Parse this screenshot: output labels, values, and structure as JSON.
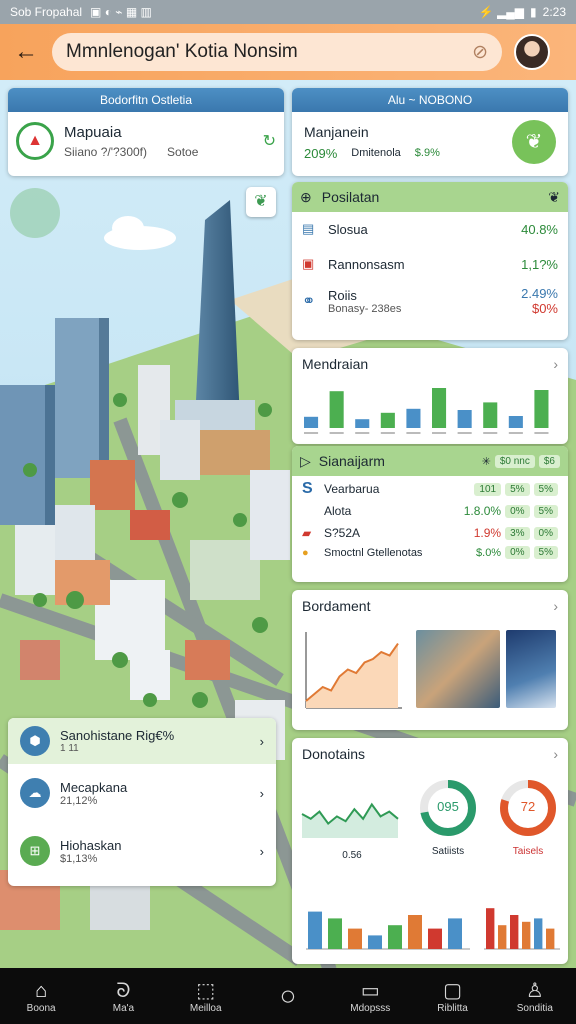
{
  "status": {
    "left": "Sob Fropahal",
    "time": "2:23"
  },
  "appbar": {
    "search_text": "Mmnlenogan' Kotia Nonsim"
  },
  "left_card": {
    "header": "Bodorfitn Ostletia",
    "title": "Mapuaia",
    "subtitle": "Siiano ?/'?300f)",
    "action": "Sotoe"
  },
  "right_card": {
    "header": "Alu ~ NOBONO",
    "title": "Manjanein",
    "value": "209%",
    "action": "Dmitenola",
    "pct": "$.9%"
  },
  "green_list": {
    "title": "Posilatan",
    "items": [
      {
        "label": "Slosua",
        "value": "40.8%"
      },
      {
        "label": "Rannonsasm",
        "value": "1,1?%"
      },
      {
        "label": "Roiis",
        "sub": "Bonasy- 238es",
        "value": "2.49%",
        "value2": "$0%"
      }
    ]
  },
  "bar_card": {
    "title": "Mendraian",
    "bars": [
      0.28,
      0.92,
      0.22,
      0.38,
      0.48,
      1.0,
      0.45,
      0.64,
      0.3,
      0.95
    ]
  },
  "stat_card": {
    "title": "Sianaijarm",
    "header_chips": [
      "$0 nnc",
      "$6"
    ],
    "rows": [
      {
        "label": "Vearbarua",
        "chips": [
          "101",
          "5%",
          "5%"
        ]
      },
      {
        "label": "Alota",
        "value": "1.8.0%",
        "chips": [
          "0%",
          "5%"
        ]
      },
      {
        "label": "S?52A",
        "value": "1.9%",
        "chips": [
          "3%",
          "0%"
        ]
      },
      {
        "label": "Smoctnl Gtellenotas",
        "value": "$.0%",
        "chips": [
          "0%",
          "5%"
        ]
      }
    ]
  },
  "media_card": {
    "title": "Bordament",
    "line_points": [
      0.1,
      0.2,
      0.3,
      0.25,
      0.45,
      0.55,
      0.5,
      0.65,
      0.7,
      0.8,
      0.75,
      0.92
    ]
  },
  "donut_card": {
    "title": "Donotains",
    "spark_label": "0.56",
    "donut1": {
      "value": "095",
      "label": "Satiists",
      "fraction": 0.72,
      "color": "#2a9a6b"
    },
    "donut2": {
      "value": "72",
      "label": "Taisels",
      "fraction": 0.8,
      "color": "#e0572a"
    },
    "bars_left": [
      0.55,
      0.45,
      0.3,
      0.2,
      0.35,
      0.5,
      0.3,
      0.45
    ],
    "bars_right": [
      0.6,
      0.35,
      0.5,
      0.4,
      0.45,
      0.3
    ]
  },
  "left_list": {
    "items": [
      {
        "title": "Sanohistane Rig€%",
        "sub": "1 11"
      },
      {
        "title": "Mecapkana",
        "sub": "21,12%"
      },
      {
        "title": "Hiohaskan",
        "sub": "$1,13%"
      }
    ]
  },
  "nav": {
    "items": [
      "Boona",
      "Ma'a",
      "Meilloa",
      "",
      "Mdopsss",
      "Riblitta",
      "Sonditia"
    ]
  },
  "colors": {
    "accent": "#f7a35c",
    "green": "#a8d58f",
    "blue": "#3a78ae"
  }
}
